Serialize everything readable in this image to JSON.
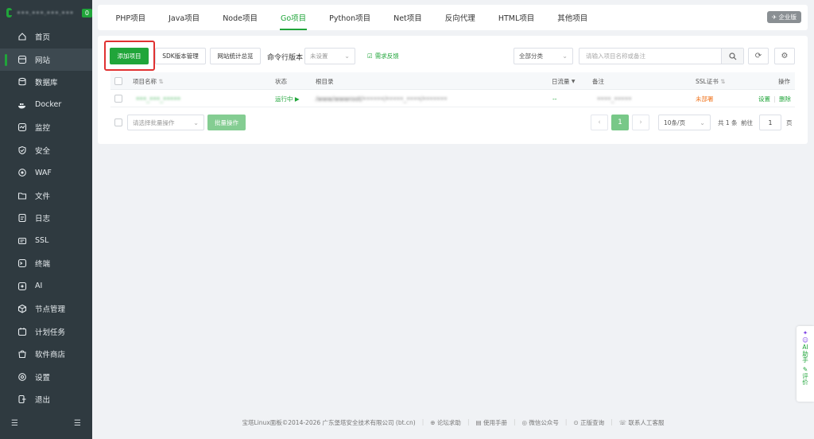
{
  "sidebar": {
    "ip": "•••.•••.•••.•••",
    "badge": "0",
    "items": [
      {
        "label": "首页",
        "icon": "home-icon"
      },
      {
        "label": "网站",
        "icon": "globe-icon"
      },
      {
        "label": "数据库",
        "icon": "database-icon"
      },
      {
        "label": "Docker",
        "icon": "docker-icon"
      },
      {
        "label": "监控",
        "icon": "monitor-icon"
      },
      {
        "label": "安全",
        "icon": "shield-icon"
      },
      {
        "label": "WAF",
        "icon": "waf-icon"
      },
      {
        "label": "文件",
        "icon": "folder-icon"
      },
      {
        "label": "日志",
        "icon": "log-icon"
      },
      {
        "label": "SSL",
        "icon": "ssl-icon"
      },
      {
        "label": "终端",
        "icon": "terminal-icon"
      },
      {
        "label": "AI",
        "icon": "ai-icon"
      },
      {
        "label": "节点管理",
        "icon": "node-icon"
      },
      {
        "label": "计划任务",
        "icon": "calendar-icon"
      },
      {
        "label": "软件商店",
        "icon": "store-icon"
      },
      {
        "label": "设置",
        "icon": "gear-icon"
      },
      {
        "label": "退出",
        "icon": "logout-icon"
      }
    ],
    "active_index": 1
  },
  "tabs": [
    "PHP项目",
    "Java项目",
    "Node项目",
    "Go项目",
    "Python项目",
    "Net项目",
    "反向代理",
    "HTML项目",
    "其他项目"
  ],
  "active_tab": 3,
  "enterprise_label": "企业版",
  "toolbar": {
    "add_label": "添加项目",
    "sdk_label": "SDK版本管理",
    "stats_label": "网站统计总览",
    "cmd_label": "命令行版本",
    "cmd_select": "未设置",
    "feedback_label": "需求反馈",
    "category_select": "全部分类",
    "search_placeholder": "请输入项目名称或备注"
  },
  "table": {
    "headers": {
      "name": "项目名称",
      "status": "状态",
      "root": "根目录",
      "traffic": "日流量",
      "remark": "备注",
      "ssl": "SSL证书",
      "ops": "操作"
    },
    "rows": [
      {
        "name": "•••_•••_•••••",
        "status": "运行中",
        "root": "/www/wwwroot/••••••/•••••_••••/•••••••",
        "traffic": "--",
        "remark": "••••_•••••",
        "ssl": "未部署",
        "op_settings": "设置",
        "op_delete": "删除"
      }
    ]
  },
  "bottom": {
    "batch_placeholder": "请选择批量操作",
    "batch_button": "批量操作",
    "current_page": "1",
    "page_size": "10条/页",
    "total": "共 1 条",
    "goto_label": "前往",
    "goto_value": "1",
    "page_unit": "页"
  },
  "footer": {
    "copyright": "宝塔Linux面板©2014-2026 广东堡塔安全技术有限公司 (bt.cn)",
    "links": [
      "论坛求助",
      "使用手册",
      "微信公众号",
      "正版查询",
      "联系人工客服"
    ]
  },
  "float": {
    "ai": "AI",
    "helper": "助手",
    "review": "评价"
  }
}
